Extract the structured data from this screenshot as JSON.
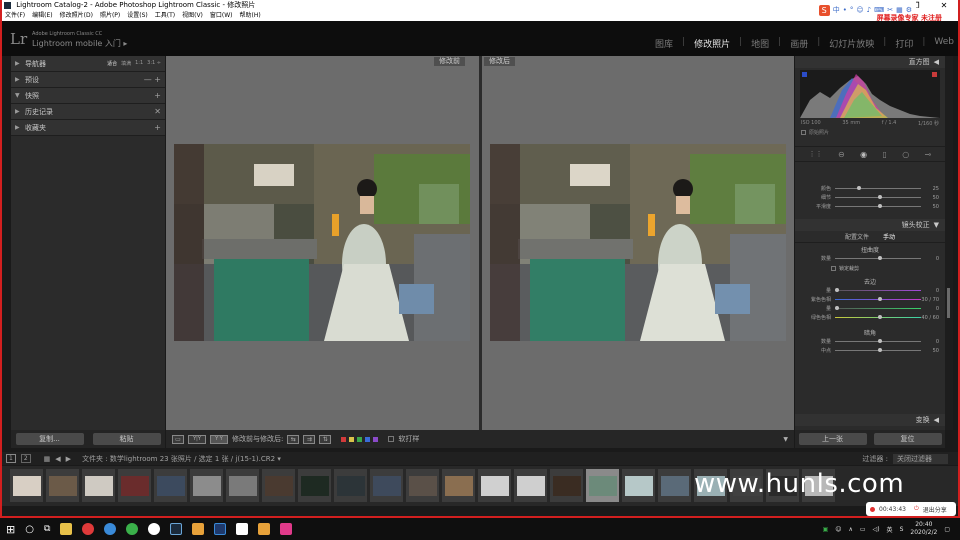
{
  "window": {
    "title": "Lightroom Catalog-2 - Adobe Photoshop Lightroom Classic - 修改照片",
    "controls": [
      "—",
      "❐",
      "✕"
    ]
  },
  "menubar": [
    "文件(F)",
    "编辑(E)",
    "修改照片(D)",
    "照片(P)",
    "设置(S)",
    "工具(T)",
    "视图(V)",
    "窗口(W)",
    "帮助(H)"
  ],
  "overlay_text": "屏幕录像专家 未注册",
  "ime": {
    "logo": "S",
    "items": [
      "中",
      "•",
      "°",
      "☺",
      "♪",
      "⌨",
      "✂",
      "▦",
      "⚙"
    ]
  },
  "lr_header": {
    "logo": "Lr",
    "sub1": "Adobe Lightroom Classic CC",
    "sub2": "Lightroom mobile 入门 ▸",
    "modules": [
      "图库",
      "修改照片",
      "地图",
      "画册",
      "幻灯片放映",
      "打印",
      "Web"
    ],
    "active_module": "修改照片"
  },
  "left_panel": {
    "sections": [
      {
        "label": "导航器",
        "extra": [
          "适合",
          "填满",
          "1:1",
          "3:1 ÷"
        ],
        "selected": "适合"
      },
      {
        "label": "预设",
        "plus": "— +"
      },
      {
        "label": "快照",
        "plus": "+"
      },
      {
        "label": "历史记录",
        "plus": "✕"
      },
      {
        "label": "收藏夹",
        "plus": "+"
      }
    ],
    "copy_button": "复制...",
    "paste_button": "粘贴"
  },
  "center": {
    "before_label": "修改前",
    "after_label": "修改后"
  },
  "toolbar": {
    "view_modes": [
      "▭",
      "Y|Y",
      "Y Y"
    ],
    "compare_label": "修改前与修改后:",
    "swap_buttons": [
      "⇆",
      "⇉",
      "⇅"
    ],
    "color_labels": [
      "#d23a3a",
      "#d9c24a",
      "#3aa84a",
      "#3a6cd8",
      "#8a4ac8"
    ],
    "soft_proof_label": "软打样"
  },
  "right_panel": {
    "histogram_title": "直方图",
    "histogram_meta": [
      "ISO 100",
      "35 mm",
      "f / 1.4",
      "1/160 秒"
    ],
    "original_photo": "原始照片",
    "color_sliders": [
      {
        "label": "颜色",
        "value": "25",
        "pos": 0.25
      },
      {
        "label": "细节",
        "value": "50",
        "pos": 0.5
      },
      {
        "label": "平滑度",
        "value": "50",
        "pos": 0.5
      }
    ],
    "lens_title": "镜头校正",
    "lens_tabs": [
      "配置文件",
      "手动"
    ],
    "active_lens_tab": "手动",
    "distortion_title": "扭曲度",
    "amount_label": "数量",
    "amount_value": "0",
    "constrain_label": "锁定裁剪",
    "defringe_title": "去边",
    "defringe_rows": [
      {
        "label": "量",
        "value": "0",
        "pos": 0.0
      },
      {
        "label": "紫色色相",
        "value": "30 / 70",
        "pos": 0.5
      },
      {
        "label": "量",
        "value": "0",
        "pos": 0.0
      },
      {
        "label": "绿色色相",
        "value": "40 / 60",
        "pos": 0.5
      }
    ],
    "vignette_title": "暗角",
    "vignette_rows": [
      {
        "label": "数量",
        "value": "0",
        "pos": 0.5
      },
      {
        "label": "中点",
        "value": "50",
        "pos": 0.5
      }
    ],
    "transform_title": "变换",
    "prev_button": "上一张",
    "reset_button": "复位"
  },
  "filmstrip": {
    "path": "文件夹 : 数学lightroom   23 张照片 / 选定 1 张 / j(15-1).CR2 ▾",
    "filter_label": "过滤器 :",
    "filter_value": "关闭过滤器",
    "page_numbers": [
      "1",
      "2"
    ],
    "thumb_colors": [
      "#d8cfc4",
      "#6b5a48",
      "#cfcac2",
      "#6a2c2c",
      "#3c4a5e",
      "#8c8c8c",
      "#7a7a7a",
      "#4a3a30",
      "#1e2a22",
      "#2c3438",
      "#3e4a5c",
      "#5a5048",
      "#8a6e50",
      "#d0d0d0",
      "#cfcfcf",
      "#3a2c22",
      "#6c8a7a",
      "#b6c8c8",
      "#5a6a78",
      "#9ab0b4",
      "#404040",
      "#2a2a2a",
      "#b8b8b8"
    ],
    "selected_index": 16
  },
  "website_watermark": "www.hunls.com",
  "recording": {
    "time": "00:43:43",
    "exit_label": "退出分享"
  },
  "taskbar": {
    "icons": [
      "#ffffff",
      "#ffffff",
      "#ffffff",
      "#e8c14a",
      "#e03a3a",
      "#3a8ad8",
      "#3ab04a",
      "#ffffff",
      "#1b2b3c",
      "#e8a23a",
      "#1f3a6c",
      "#ffffff",
      "#e8a23a",
      "#e03a8a"
    ],
    "time": "20:40",
    "date": "2020/2/2",
    "tray_text": "英"
  }
}
